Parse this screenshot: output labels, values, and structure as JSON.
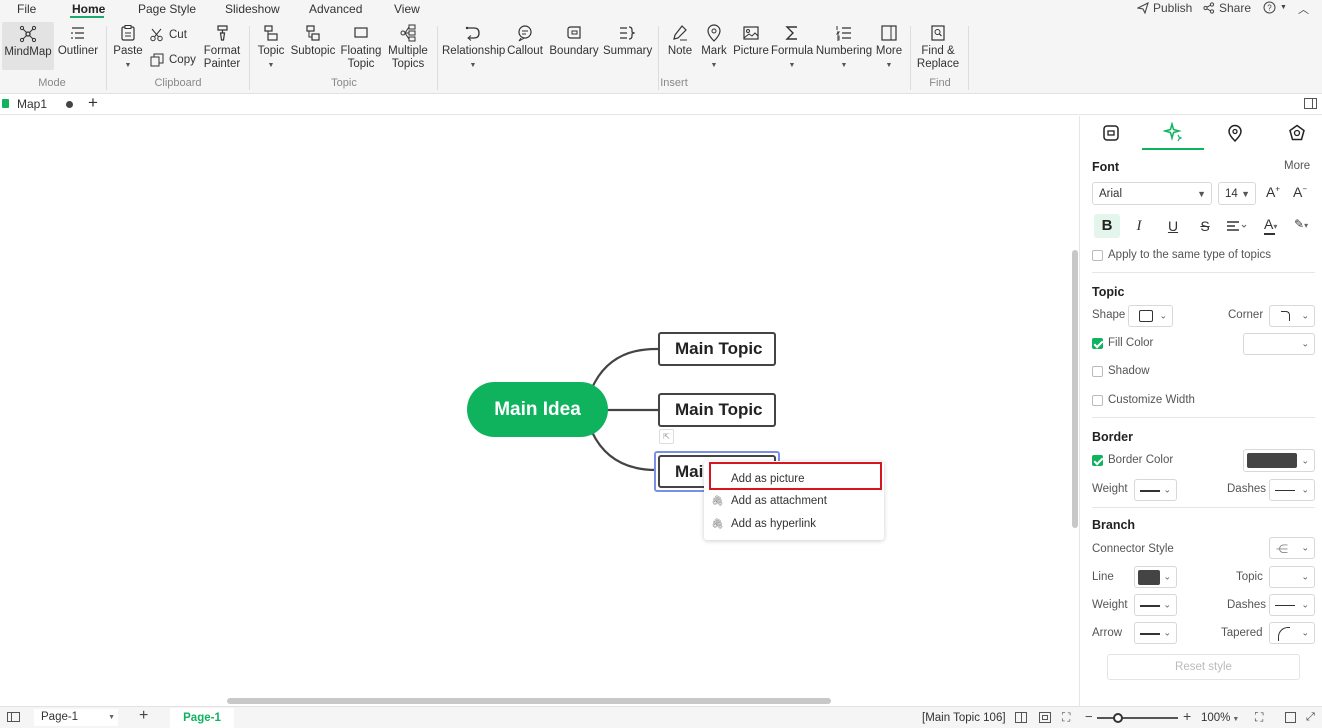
{
  "menubar": {
    "items": [
      "File",
      "Home",
      "Page Style",
      "Slideshow",
      "Advanced",
      "View"
    ],
    "publish": "Publish",
    "share": "Share"
  },
  "ribbon": {
    "mode": {
      "mindmap": "MindMap",
      "outliner": "Outliner",
      "group": "Mode"
    },
    "clipboard": {
      "paste": "Paste",
      "cut": "Cut",
      "copy": "Copy",
      "format_painter_1": "Format",
      "format_painter_2": "Painter",
      "group": "Clipboard"
    },
    "topic": {
      "topic": "Topic",
      "subtopic": "Subtopic",
      "floating_1": "Floating",
      "floating_2": "Topic",
      "multiple_1": "Multiple",
      "multiple_2": "Topics",
      "group": "Topic"
    },
    "insert": {
      "relationship": "Relationship",
      "callout": "Callout",
      "boundary": "Boundary",
      "summary": "Summary",
      "note": "Note",
      "mark": "Mark",
      "picture": "Picture",
      "formula": "Formula",
      "numbering": "Numbering",
      "more": "More",
      "group": "Insert"
    },
    "find": {
      "label_1": "Find &",
      "label_2": "Replace",
      "group": "Find"
    }
  },
  "tabs": {
    "doc_title": "Map1"
  },
  "canvas": {
    "central": "Main Idea",
    "topics": [
      "Main Topic",
      "Main Topic",
      "Main Topic"
    ],
    "topic3_visible": "Mai"
  },
  "context_menu": {
    "items": [
      "Add as picture",
      "Add as attachment",
      "Add as hyperlink"
    ]
  },
  "panel": {
    "font_heading": "Font",
    "more": "More",
    "font_family": "Arial",
    "font_size": "14",
    "apply_same": "Apply to the same type of topics",
    "topic_heading": "Topic",
    "shape": "Shape",
    "corner": "Corner",
    "fill_color": "Fill Color",
    "shadow": "Shadow",
    "customize_width": "Customize Width",
    "border_heading": "Border",
    "border_color": "Border Color",
    "weight": "Weight",
    "dashes": "Dashes",
    "branch_heading": "Branch",
    "connector_style": "Connector Style",
    "line": "Line",
    "topic_label": "Topic",
    "weight2": "Weight",
    "dashes2": "Dashes",
    "arrow": "Arrow",
    "tapered": "Tapered",
    "reset": "Reset style",
    "fill_checked": true,
    "border_checked": true,
    "colors": {
      "accent": "#0fb35e",
      "border_swatch": "#444444",
      "line_swatch": "#444444"
    }
  },
  "status": {
    "page_select": "Page-1",
    "page_tab": "Page-1",
    "selection": "[Main Topic 106]",
    "zoom": "100%"
  }
}
